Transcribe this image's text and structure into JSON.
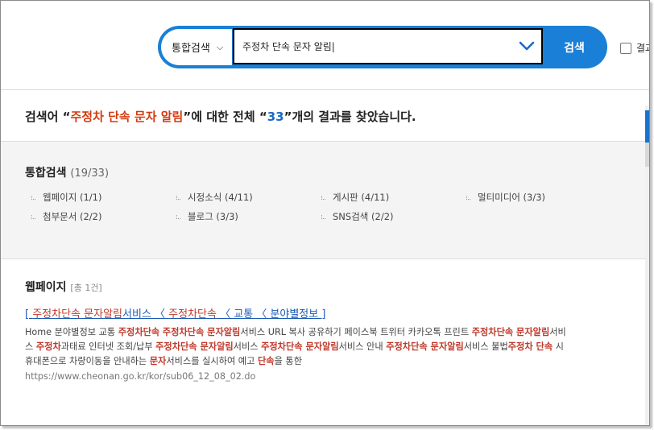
{
  "search": {
    "scope_label": "통합검색",
    "query": "주정차 단속 문자 알림|",
    "button_label": "검색",
    "research_label": "결과"
  },
  "summary": {
    "prefix": "검색어 “",
    "keyword": "주정차 단속 문자 알림",
    "middle": "”에 대한 전체 “",
    "count": "33",
    "suffix": "”개의 결과를 찾았습니다."
  },
  "categories": {
    "title": "통합검색",
    "count": "(19/33)",
    "items": [
      {
        "label": "웹페이지 (1/1)"
      },
      {
        "label": "시정소식 (4/11)"
      },
      {
        "label": "게시판 (4/11)"
      },
      {
        "label": "멀티미디어 (3/3)"
      },
      {
        "label": "첨부문서 (2/2)"
      },
      {
        "label": "블로그 (3/3)"
      },
      {
        "label": "SNS검색 (2/2)"
      }
    ]
  },
  "webpage": {
    "title": "웹페이지",
    "total": "[총 1건]",
    "result": {
      "link_parts": [
        "[ ",
        "주정차단속 문자알림",
        "서비스 〈 ",
        "주정차단속",
        " 〈 교통 〈 분야별정보 ]"
      ],
      "desc_lines": [
        [
          "Home 분야별정보 교통 ",
          "주정차단속",
          " ",
          "주정차단속 문자알림",
          "서비스 URL 복사 공유하기 페이스북 트위터 카카오톡 프린트 ",
          "주정차단속 문자알림",
          "서비"
        ],
        [
          "스 ",
          "주정차",
          "과태료 인터넷 조회/납부 ",
          "주정차단속 문자알림",
          "서비스 ",
          "주정차단속 문자알림",
          "서비스 안내 ",
          "주정차단속 문자알림",
          "서비스 불법",
          "주정차 단속",
          " 시"
        ],
        [
          "휴대폰으로 차량이동을 안내하는 ",
          "문자",
          "서비스를 실시하여 예고 ",
          "단속",
          "을 통한"
        ]
      ],
      "url": "https://www.cheonan.go.kr/kor/sub06_12_08_02.do"
    }
  },
  "colors": {
    "accent": "#1a7fd6",
    "highlight": "#c0392b",
    "summary_keyword": "#d43a0f",
    "summary_count": "#1a6ac7"
  }
}
